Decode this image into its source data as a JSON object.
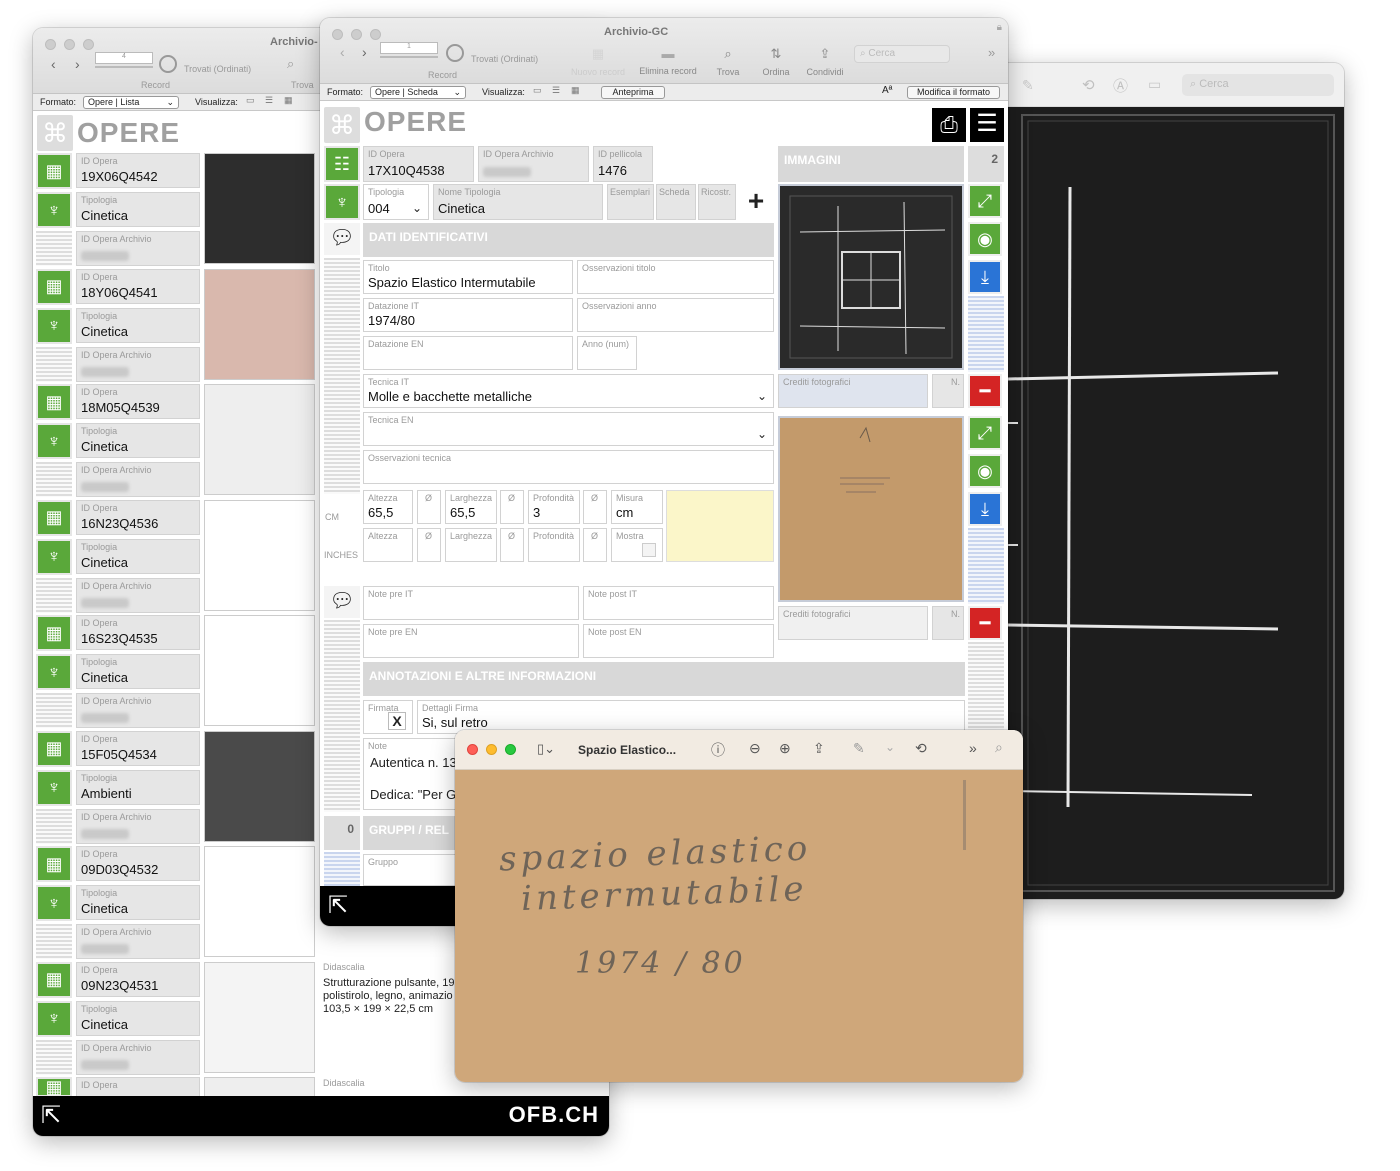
{
  "back_window": {
    "title": "Archivio-",
    "record_value": "4",
    "found_label": "Trovati (Ordinati)",
    "record_label": "Record",
    "find_label": "Trova",
    "format_label": "Formato:",
    "format_value": "Opere | Lista",
    "view_label": "Visualizza:",
    "heading": "OPERE",
    "brand": "OFB.CH",
    "rows": [
      {
        "id_label": "ID Opera",
        "id": "19X06Q4542",
        "type_label": "Tipologia",
        "type": "Cinetica",
        "arch_label": "ID Opera Archivio"
      },
      {
        "id_label": "ID Opera",
        "id": "18Y06Q4541",
        "type_label": "Tipologia",
        "type": "Cinetica",
        "arch_label": "ID Opera Archivio"
      },
      {
        "id_label": "ID Opera",
        "id": "18M05Q4539",
        "type_label": "Tipologia",
        "type": "Cinetica",
        "arch_label": "ID Opera Archivio"
      },
      {
        "id_label": "ID Opera",
        "id": "16N23Q4536",
        "type_label": "Tipologia",
        "type": "Cinetica",
        "arch_label": "ID Opera Archivio"
      },
      {
        "id_label": "ID Opera",
        "id": "16S23Q4535",
        "type_label": "Tipologia",
        "type": "Cinetica",
        "arch_label": "ID Opera Archivio"
      },
      {
        "id_label": "ID Opera",
        "id": "15F05Q4534",
        "type_label": "Tipologia",
        "type": "Ambienti",
        "arch_label": "ID Opera Archivio"
      },
      {
        "id_label": "ID Opera",
        "id": "09D03Q4532",
        "type_label": "Tipologia",
        "type": "Cinetica",
        "arch_label": "ID Opera Archivio"
      },
      {
        "id_label": "ID Opera",
        "id": "09N23Q4531",
        "type_label": "Tipologia",
        "type": "Cinetica",
        "arch_label": "ID Opera Archivio"
      }
    ],
    "last_row_label": "ID Opera",
    "caption_label": "Didascalia",
    "caption_lines": [
      "Strutturazione pulsante, 19",
      "polistirolo, legno, animazio",
      "103,5 × 199 × 22,5 cm"
    ],
    "caption_label_2": "Didascalia"
  },
  "main_window": {
    "title": "Archivio-GC",
    "record_value": "1",
    "found_label": "Trovati (Ordinati)",
    "record_label": "Record",
    "toolbar": {
      "new": "Nuovo record",
      "delete": "Elimina record",
      "find": "Trova",
      "sort": "Ordina",
      "share": "Condividi",
      "search_placeholder": "Cerca"
    },
    "format_label": "Formato:",
    "format_value": "Opere | Scheda",
    "view_label": "Visualizza:",
    "preview_btn": "Anteprima",
    "edit_format_btn": "Modifica il formato",
    "heading": "OPERE",
    "fields": {
      "id_opera_label": "ID Opera",
      "id_opera": "17X10Q4538",
      "id_archivio_label": "ID Opera Archivio",
      "id_pellicola_label": "ID pellicola",
      "id_pellicola": "1476",
      "tipologia_label": "Tipologia",
      "tipologia": "004",
      "nome_tipologia_label": "Nome Tipologia",
      "nome_tipologia": "Cinetica",
      "esemplari": "Esemplari",
      "scheda": "Scheda",
      "ricostr": "Ricostr.",
      "titolo_label": "Titolo",
      "titolo": "Spazio Elastico Intermutabile",
      "oss_titolo_label": "Osservazioni titolo",
      "datazione_it_label": "Datazione IT",
      "datazione_it": "1974/80",
      "oss_anno_label": "Osservazioni anno",
      "datazione_en_label": "Datazione EN",
      "anno_num_label": "Anno (num)",
      "tecnica_it_label": "Tecnica IT",
      "tecnica_it": "Molle e bacchette metalliche",
      "tecnica_en_label": "Tecnica EN",
      "oss_tecnica_label": "Osservazioni tecnica",
      "cm_label": "CM",
      "inches_label": "INCHES",
      "altezza_label": "Altezza",
      "altezza": "65,5",
      "diam_label": "Ø",
      "larghezza_label": "Larghezza",
      "larghezza": "65,5",
      "profondita_label": "Profondità",
      "profondita": "3",
      "misura_label": "Misura",
      "misura": "cm",
      "mostra_label": "Mostra",
      "note_pre_it": "Note pre IT",
      "note_post_it": "Note post IT",
      "note_pre_en": "Note pre EN",
      "note_post_en": "Note post EN",
      "firma_label": "Firmata",
      "firma_check": "X",
      "dettagli_firma_label": "Dettagli Firma",
      "dettagli_firma": "Si, sul retro",
      "note_label": "Note",
      "note_line1": "Autentica n. 13",
      "note_line2": "Dedica: \"Per Ga",
      "gruppo_label": "Gruppo",
      "gruppi_count": "0"
    },
    "sections": {
      "dati": "DATI IDENTIFICATIVI",
      "annotazioni": "ANNOTAZIONI E ALTRE INFORMAZIONI",
      "gruppi": "GRUPPI / REL",
      "immagini": "IMMAGINI"
    },
    "images_count": "2",
    "crediti_label": "Crediti fotografici",
    "n_label": "N."
  },
  "preview_window": {
    "title": "Spazio Elastico...",
    "handwriting": [
      "spazio elastico",
      "intermutabile",
      "1974 / 80"
    ]
  },
  "right_window": {
    "search_placeholder": "Cerca"
  },
  "colors": {
    "green": "#5aa83a",
    "blue": "#2a74d6",
    "red": "#d42424"
  }
}
